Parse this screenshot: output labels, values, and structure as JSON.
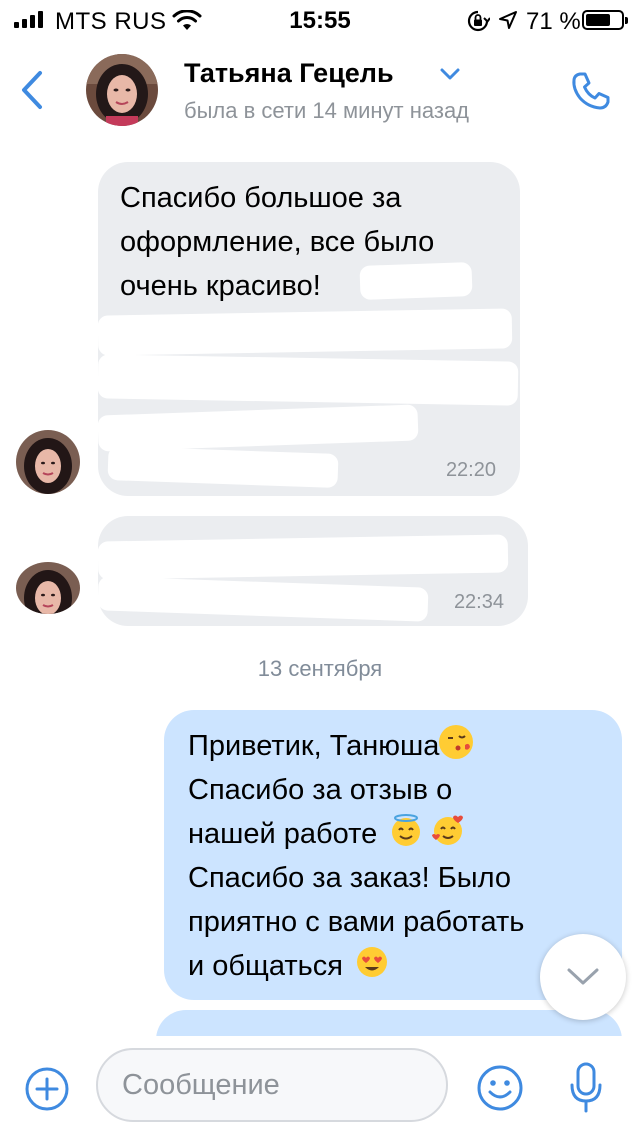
{
  "status_bar": {
    "carrier": "MTS RUS",
    "time": "15:55",
    "battery_percent": "71 %",
    "battery_level": 0.71
  },
  "header": {
    "contact_name": "Татьяна Гецель",
    "contact_status": "была в сети 14 минут назад"
  },
  "messages": [
    {
      "direction": "incoming",
      "text": "Спасибо большое за\nоформление, все было\nочень красиво!",
      "time": "22:20"
    },
    {
      "direction": "incoming",
      "text": "",
      "time": "22:34"
    },
    {
      "direction": "outgoing",
      "line1": "Приветик, Танюша",
      "line2": "Спасибо за отзыв о",
      "line3": "нашей работе",
      "line4": "Спасибо за заказ! Было",
      "line5": "приятно с вами работать",
      "line6": "и общаться"
    }
  ],
  "date_separator": "13 сентября",
  "input": {
    "placeholder": "Сообщение"
  },
  "colors": {
    "accent": "#3f8ae0",
    "incoming_bubble": "#ebedf0",
    "outgoing_bubble": "#cce4ff",
    "secondary_text": "#8e9399"
  },
  "icons": [
    "signal-icon",
    "wifi-icon",
    "rotation-lock-icon",
    "location-icon",
    "battery-icon",
    "back-chevron-icon",
    "chevron-down-icon",
    "phone-icon",
    "add-icon",
    "smile-icon",
    "microphone-icon",
    "scroll-down-icon"
  ]
}
